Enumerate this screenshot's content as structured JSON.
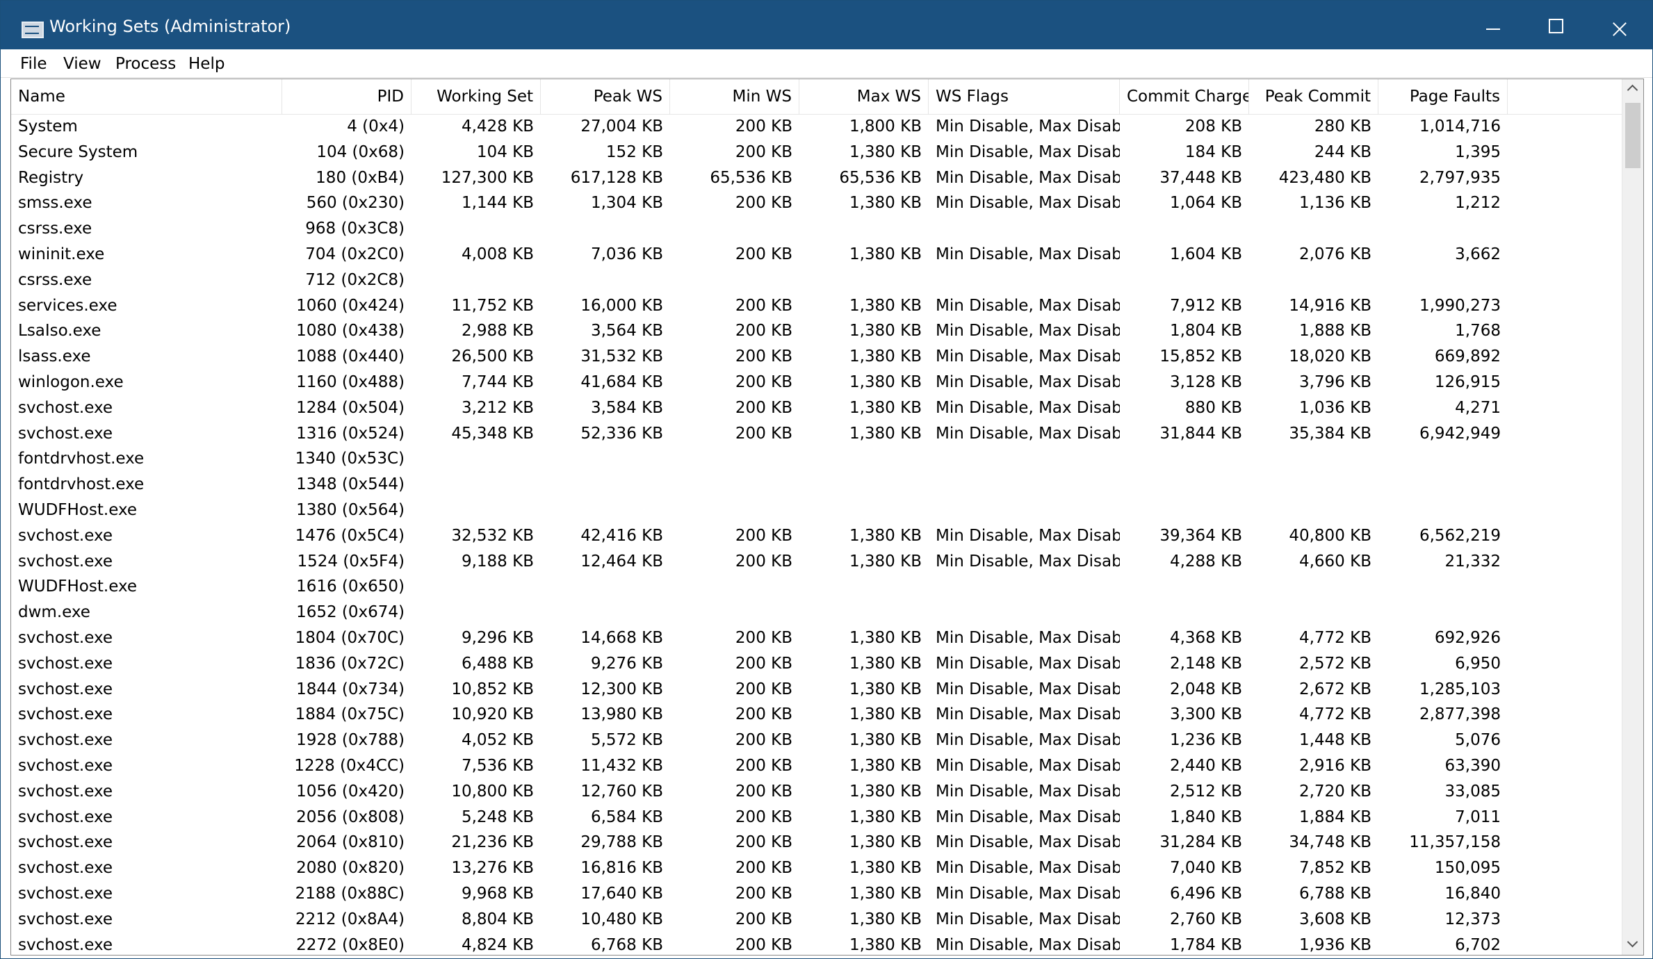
{
  "window": {
    "title": "Working Sets (Administrator)"
  },
  "icons": {
    "app": "task-list-icon",
    "minimize": "minimize-icon",
    "maximize": "maximize-icon",
    "close": "close-icon"
  },
  "menu": [
    "File",
    "View",
    "Process",
    "Help"
  ],
  "columns": [
    "Name",
    "PID",
    "Working Set",
    "Peak WS",
    "Min WS",
    "Max WS",
    "WS Flags",
    "Commit Charge",
    "Peak Commit",
    "Page Faults"
  ],
  "rows": [
    [
      "System",
      "4 (0x4)",
      "4,428 KB",
      "27,004 KB",
      "200 KB",
      "1,800 KB",
      "Min Disable, Max Disable",
      "208 KB",
      "280 KB",
      "1,014,716"
    ],
    [
      "Secure System",
      "104 (0x68)",
      "104 KB",
      "152 KB",
      "200 KB",
      "1,380 KB",
      "Min Disable, Max Disable",
      "184 KB",
      "244 KB",
      "1,395"
    ],
    [
      "Registry",
      "180 (0xB4)",
      "127,300 KB",
      "617,128 KB",
      "65,536 KB",
      "65,536 KB",
      "Min Disable, Max Disable",
      "37,448 KB",
      "423,480 KB",
      "2,797,935"
    ],
    [
      "smss.exe",
      "560 (0x230)",
      "1,144 KB",
      "1,304 KB",
      "200 KB",
      "1,380 KB",
      "Min Disable, Max Disable",
      "1,064 KB",
      "1,136 KB",
      "1,212"
    ],
    [
      "csrss.exe",
      "968 (0x3C8)",
      "",
      "",
      "",
      "",
      "",
      "",
      "",
      ""
    ],
    [
      "wininit.exe",
      "704 (0x2C0)",
      "4,008 KB",
      "7,036 KB",
      "200 KB",
      "1,380 KB",
      "Min Disable, Max Disable",
      "1,604 KB",
      "2,076 KB",
      "3,662"
    ],
    [
      "csrss.exe",
      "712 (0x2C8)",
      "",
      "",
      "",
      "",
      "",
      "",
      "",
      ""
    ],
    [
      "services.exe",
      "1060 (0x424)",
      "11,752 KB",
      "16,000 KB",
      "200 KB",
      "1,380 KB",
      "Min Disable, Max Disable",
      "7,912 KB",
      "14,916 KB",
      "1,990,273"
    ],
    [
      "LsaIso.exe",
      "1080 (0x438)",
      "2,988 KB",
      "3,564 KB",
      "200 KB",
      "1,380 KB",
      "Min Disable, Max Disable",
      "1,804 KB",
      "1,888 KB",
      "1,768"
    ],
    [
      "lsass.exe",
      "1088 (0x440)",
      "26,500 KB",
      "31,532 KB",
      "200 KB",
      "1,380 KB",
      "Min Disable, Max Disable",
      "15,852 KB",
      "18,020 KB",
      "669,892"
    ],
    [
      "winlogon.exe",
      "1160 (0x488)",
      "7,744 KB",
      "41,684 KB",
      "200 KB",
      "1,380 KB",
      "Min Disable, Max Disable",
      "3,128 KB",
      "3,796 KB",
      "126,915"
    ],
    [
      "svchost.exe",
      "1284 (0x504)",
      "3,212 KB",
      "3,584 KB",
      "200 KB",
      "1,380 KB",
      "Min Disable, Max Disable",
      "880 KB",
      "1,036 KB",
      "4,271"
    ],
    [
      "svchost.exe",
      "1316 (0x524)",
      "45,348 KB",
      "52,336 KB",
      "200 KB",
      "1,380 KB",
      "Min Disable, Max Disable",
      "31,844 KB",
      "35,384 KB",
      "6,942,949"
    ],
    [
      "fontdrvhost.exe",
      "1340 (0x53C)",
      "",
      "",
      "",
      "",
      "",
      "",
      "",
      ""
    ],
    [
      "fontdrvhost.exe",
      "1348 (0x544)",
      "",
      "",
      "",
      "",
      "",
      "",
      "",
      ""
    ],
    [
      "WUDFHost.exe",
      "1380 (0x564)",
      "",
      "",
      "",
      "",
      "",
      "",
      "",
      ""
    ],
    [
      "svchost.exe",
      "1476 (0x5C4)",
      "32,532 KB",
      "42,416 KB",
      "200 KB",
      "1,380 KB",
      "Min Disable, Max Disable",
      "39,364 KB",
      "40,800 KB",
      "6,562,219"
    ],
    [
      "svchost.exe",
      "1524 (0x5F4)",
      "9,188 KB",
      "12,464 KB",
      "200 KB",
      "1,380 KB",
      "Min Disable, Max Disable",
      "4,288 KB",
      "4,660 KB",
      "21,332"
    ],
    [
      "WUDFHost.exe",
      "1616 (0x650)",
      "",
      "",
      "",
      "",
      "",
      "",
      "",
      ""
    ],
    [
      "dwm.exe",
      "1652 (0x674)",
      "",
      "",
      "",
      "",
      "",
      "",
      "",
      ""
    ],
    [
      "svchost.exe",
      "1804 (0x70C)",
      "9,296 KB",
      "14,668 KB",
      "200 KB",
      "1,380 KB",
      "Min Disable, Max Disable",
      "4,368 KB",
      "4,772 KB",
      "692,926"
    ],
    [
      "svchost.exe",
      "1836 (0x72C)",
      "6,488 KB",
      "9,276 KB",
      "200 KB",
      "1,380 KB",
      "Min Disable, Max Disable",
      "2,148 KB",
      "2,572 KB",
      "6,950"
    ],
    [
      "svchost.exe",
      "1844 (0x734)",
      "10,852 KB",
      "12,300 KB",
      "200 KB",
      "1,380 KB",
      "Min Disable, Max Disable",
      "2,048 KB",
      "2,672 KB",
      "1,285,103"
    ],
    [
      "svchost.exe",
      "1884 (0x75C)",
      "10,920 KB",
      "13,980 KB",
      "200 KB",
      "1,380 KB",
      "Min Disable, Max Disable",
      "3,300 KB",
      "4,772 KB",
      "2,877,398"
    ],
    [
      "svchost.exe",
      "1928 (0x788)",
      "4,052 KB",
      "5,572 KB",
      "200 KB",
      "1,380 KB",
      "Min Disable, Max Disable",
      "1,236 KB",
      "1,448 KB",
      "5,076"
    ],
    [
      "svchost.exe",
      "1228 (0x4CC)",
      "7,536 KB",
      "11,432 KB",
      "200 KB",
      "1,380 KB",
      "Min Disable, Max Disable",
      "2,440 KB",
      "2,916 KB",
      "63,390"
    ],
    [
      "svchost.exe",
      "1056 (0x420)",
      "10,800 KB",
      "12,760 KB",
      "200 KB",
      "1,380 KB",
      "Min Disable, Max Disable",
      "2,512 KB",
      "2,720 KB",
      "33,085"
    ],
    [
      "svchost.exe",
      "2056 (0x808)",
      "5,248 KB",
      "6,584 KB",
      "200 KB",
      "1,380 KB",
      "Min Disable, Max Disable",
      "1,840 KB",
      "1,884 KB",
      "7,011"
    ],
    [
      "svchost.exe",
      "2064 (0x810)",
      "21,236 KB",
      "29,788 KB",
      "200 KB",
      "1,380 KB",
      "Min Disable, Max Disable",
      "31,284 KB",
      "34,748 KB",
      "11,357,158"
    ],
    [
      "svchost.exe",
      "2080 (0x820)",
      "13,276 KB",
      "16,816 KB",
      "200 KB",
      "1,380 KB",
      "Min Disable, Max Disable",
      "7,040 KB",
      "7,852 KB",
      "150,095"
    ],
    [
      "svchost.exe",
      "2188 (0x88C)",
      "9,968 KB",
      "17,640 KB",
      "200 KB",
      "1,380 KB",
      "Min Disable, Max Disable",
      "6,496 KB",
      "6,788 KB",
      "16,840"
    ],
    [
      "svchost.exe",
      "2212 (0x8A4)",
      "8,804 KB",
      "10,480 KB",
      "200 KB",
      "1,380 KB",
      "Min Disable, Max Disable",
      "2,760 KB",
      "3,608 KB",
      "12,373"
    ],
    [
      "svchost.exe",
      "2272 (0x8E0)",
      "4,824 KB",
      "6,768 KB",
      "200 KB",
      "1,380 KB",
      "Min Disable, Max Disable",
      "1,784 KB",
      "1,936 KB",
      "6,702"
    ]
  ]
}
